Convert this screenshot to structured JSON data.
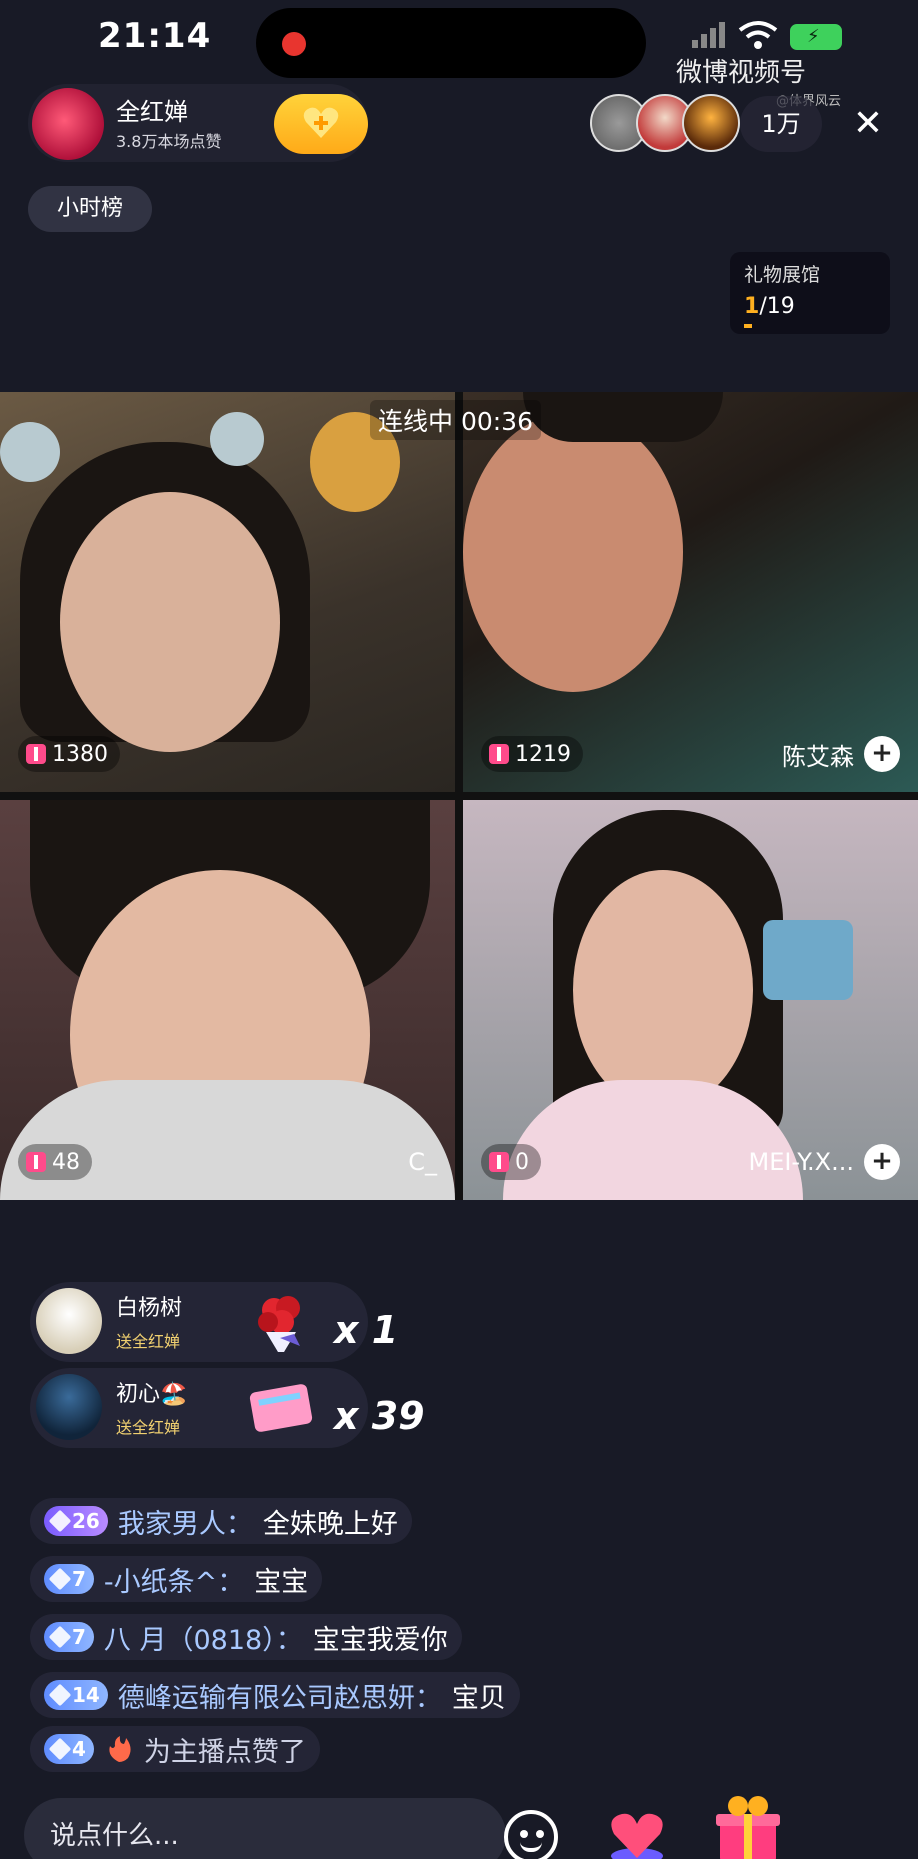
{
  "status_bar": {
    "time": "21:14"
  },
  "watermark": {
    "logo": "微博视频号",
    "sub": "@体界风云"
  },
  "host": {
    "name": "全红婵",
    "likes": "3.8万本场点赞"
  },
  "viewer_count": "1万",
  "rank_tag": "小时榜",
  "gift_hall": {
    "label": "礼物展馆",
    "current": "1",
    "total": "/19"
  },
  "link_timer": "连线中 00:36",
  "tiles": [
    {
      "score": "1380",
      "name": ""
    },
    {
      "score": "1219",
      "name": "陈艾森"
    },
    {
      "score": "48",
      "name": "C_"
    },
    {
      "score": "0",
      "name": "MEI-Y.X..."
    }
  ],
  "gifts": [
    {
      "user": "白杨树",
      "to": "送全红婵",
      "multiplier": "x 1",
      "gift_icon": "rose-bouquet-icon"
    },
    {
      "user": "初心🏖️",
      "to": "送全红婵",
      "multiplier": "x 39",
      "gift_icon": "pink-envelope-icon"
    }
  ],
  "chat": [
    {
      "level": "26",
      "badge_color": "#8a6bff",
      "name": "我家男人：",
      "text": "全妹晚上好"
    },
    {
      "level": "7",
      "badge_color": "#6f97ff",
      "name": "-小纸条^：",
      "text": "宝宝"
    },
    {
      "level": "7",
      "badge_color": "#6f97ff",
      "name": "八 月（0818）：",
      "text": "宝宝我爱你"
    },
    {
      "level": "14",
      "badge_color": "#6f97ff",
      "name": "德峰运输有限公司赵思妍：",
      "text": "宝贝"
    },
    {
      "level": "4",
      "badge_color": "#6f97ff",
      "name": "",
      "text": "为主播点赞了"
    }
  ],
  "input": {
    "placeholder": "说点什么..."
  },
  "colors": {
    "background": "#181a26",
    "follow_button": "#ffc02a",
    "score_icon": "#ff4b8b",
    "gift_sender_subtext": "#f0d070"
  }
}
